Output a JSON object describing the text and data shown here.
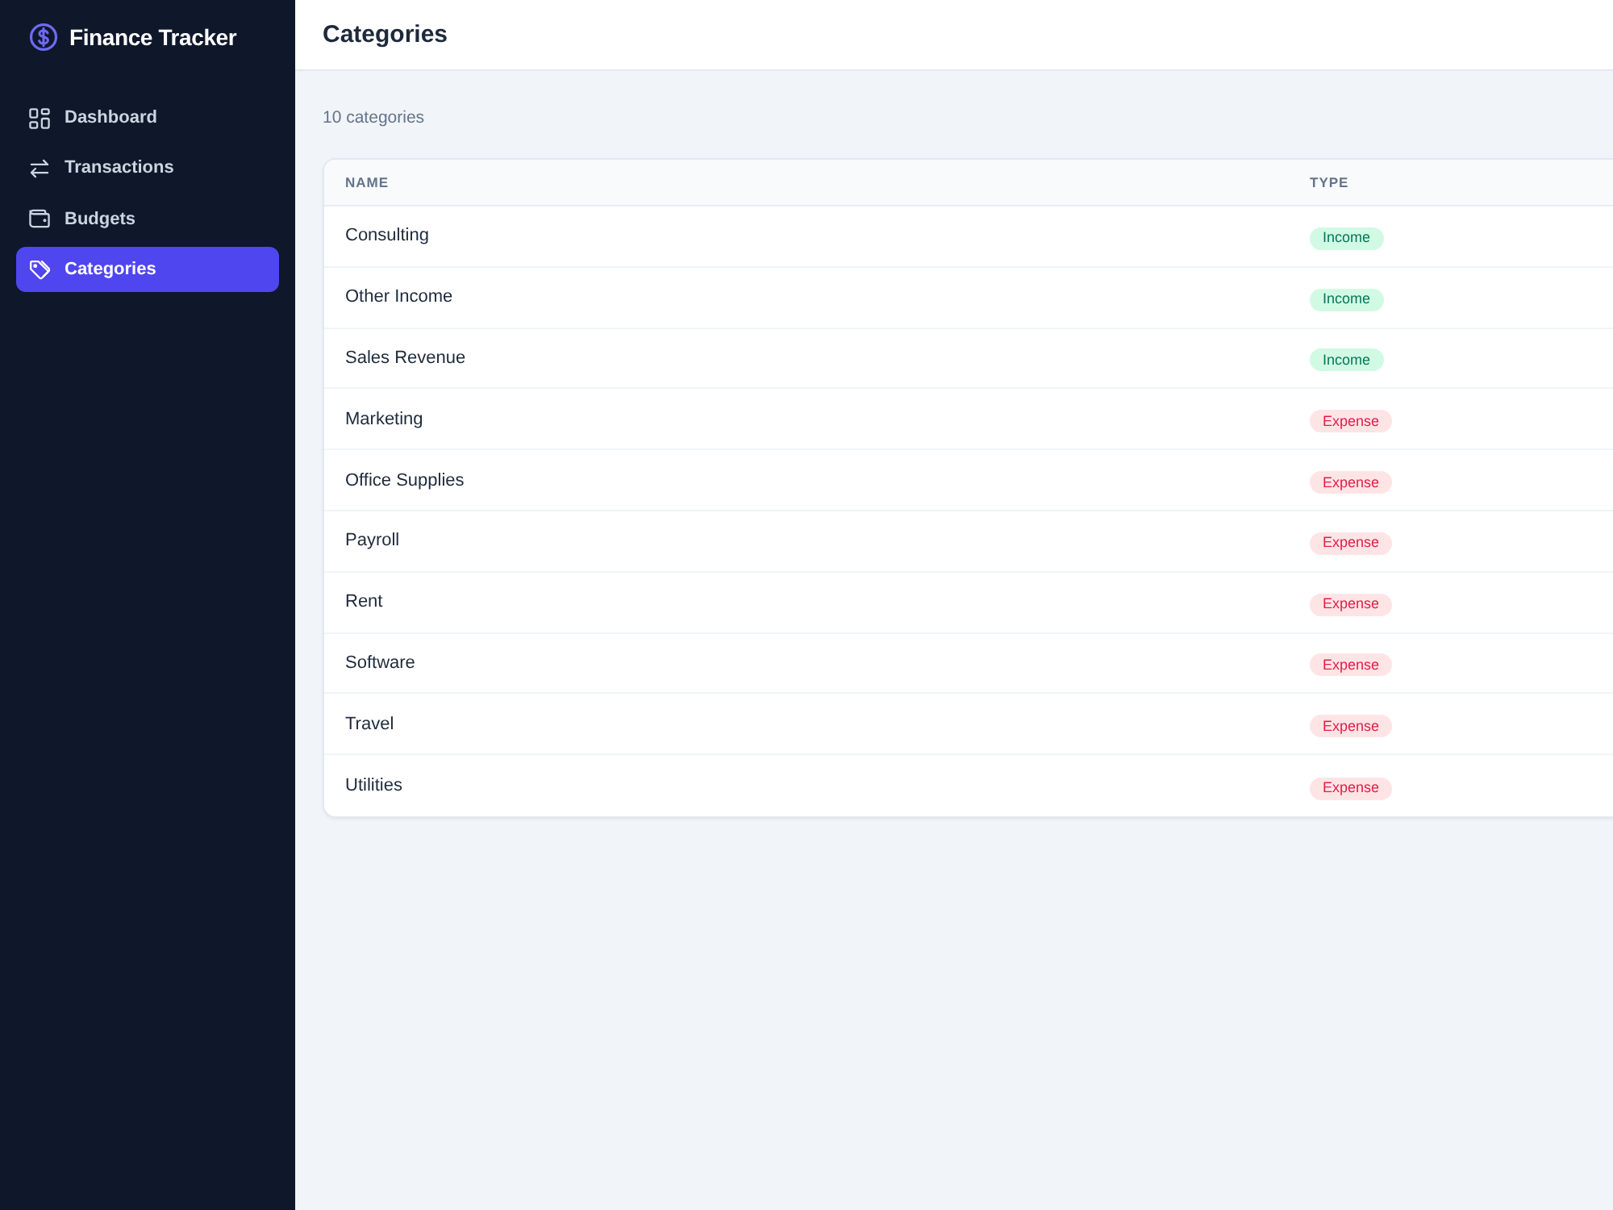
{
  "app": {
    "title": "Finance Tracker"
  },
  "sidebar": {
    "items": [
      {
        "label": "Dashboard",
        "selected": false
      },
      {
        "label": "Transactions",
        "selected": false
      },
      {
        "label": "Budgets",
        "selected": false
      },
      {
        "label": "Categories",
        "selected": true
      }
    ]
  },
  "header": {
    "title": "Categories"
  },
  "summary": "10 categories",
  "table": {
    "columns": [
      "NAME",
      "TYPE"
    ],
    "rows": [
      {
        "name": "Consulting",
        "type": {
          "label": "Income",
          "kind": "income"
        }
      },
      {
        "name": "Other Income",
        "type": {
          "label": "Income",
          "kind": "income"
        }
      },
      {
        "name": "Sales Revenue",
        "type": {
          "label": "Income",
          "kind": "income"
        }
      },
      {
        "name": "Marketing",
        "type": {
          "label": "Expense",
          "kind": "expense"
        }
      },
      {
        "name": "Office Supplies",
        "type": {
          "label": "Expense",
          "kind": "expense"
        }
      },
      {
        "name": "Payroll",
        "type": {
          "label": "Expense",
          "kind": "expense"
        }
      },
      {
        "name": "Rent",
        "type": {
          "label": "Expense",
          "kind": "expense"
        }
      },
      {
        "name": "Software",
        "type": {
          "label": "Expense",
          "kind": "expense"
        }
      },
      {
        "name": "Travel",
        "type": {
          "label": "Expense",
          "kind": "expense"
        }
      },
      {
        "name": "Utilities",
        "type": {
          "label": "Expense",
          "kind": "expense"
        }
      }
    ]
  }
}
